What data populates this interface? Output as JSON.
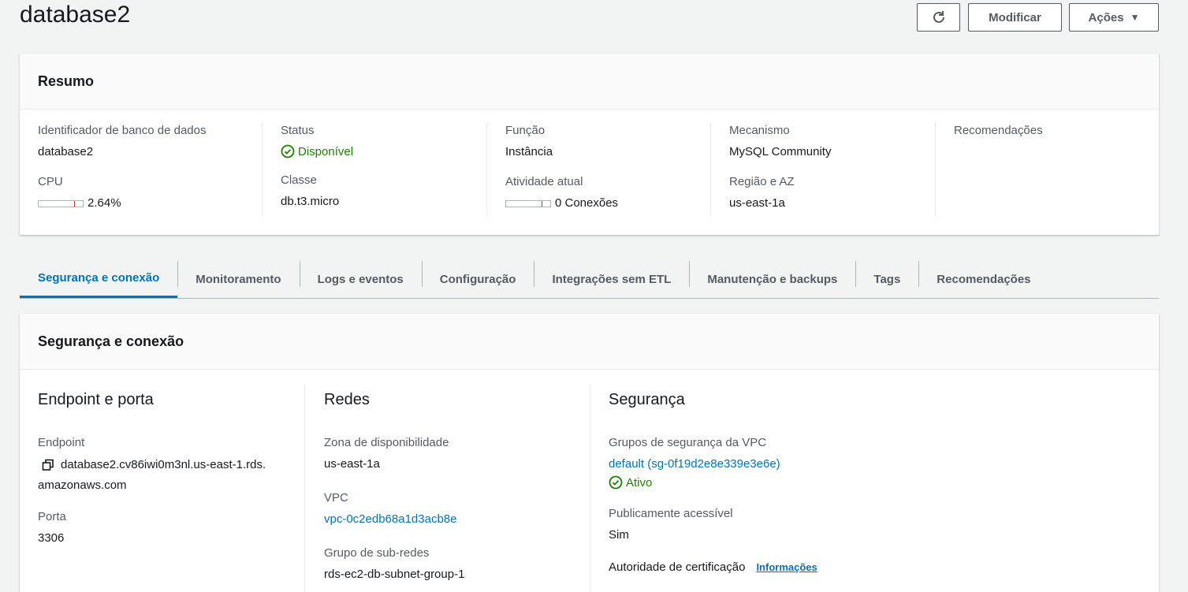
{
  "header": {
    "title": "database2",
    "modify_label": "Modificar",
    "actions_label": "Ações"
  },
  "summary": {
    "title": "Resumo",
    "identifier_label": "Identificador de banco de dados",
    "identifier_value": "database2",
    "cpu_label": "CPU",
    "cpu_value": "2.64%",
    "cpu_fraction": 0.0264,
    "status_label": "Status",
    "status_value": "Disponível",
    "class_label": "Classe",
    "class_value": "db.t3.micro",
    "role_label": "Função",
    "role_value": "Instância",
    "activity_label": "Atividade atual",
    "activity_value": "0 Conexões",
    "engine_label": "Mecanismo",
    "engine_value": "MySQL Community",
    "region_label": "Região e AZ",
    "region_value": "us-east-1a",
    "recommendations_label": "Recomendações"
  },
  "tabs": [
    {
      "label": "Segurança e conexão"
    },
    {
      "label": "Monitoramento"
    },
    {
      "label": "Logs e eventos"
    },
    {
      "label": "Configuração"
    },
    {
      "label": "Integrações sem ETL"
    },
    {
      "label": "Manutenção e backups"
    },
    {
      "label": "Tags"
    },
    {
      "label": "Recomendações"
    }
  ],
  "security": {
    "title": "Segurança e conexão",
    "endpoint_section": "Endpoint e porta",
    "endpoint_label": "Endpoint",
    "endpoint_line1": "database2.cv86iwi0m3nl.us-east-1.rds.",
    "endpoint_line2": "amazonaws.com",
    "port_label": "Porta",
    "port_value": "3306",
    "network_section": "Redes",
    "az_label": "Zona de disponibilidade",
    "az_value": "us-east-1a",
    "vpc_label": "VPC",
    "vpc_value": "vpc-0c2edb68a1d3acb8e",
    "subnet_label": "Grupo de sub-redes",
    "subnet_value": "rds-ec2-db-subnet-group-1",
    "security_section": "Segurança",
    "sg_label": "Grupos de segurança da VPC",
    "sg_value": "default (sg-0f19d2e8e339e3e6e)",
    "sg_status": "Ativo",
    "public_label": "Publicamente acessível",
    "public_value": "Sim",
    "ca_label": "Autoridade de certificação",
    "ca_info": "Informações"
  },
  "colors": {
    "accent": "#0073bb",
    "success": "#1d8102"
  },
  "icons": {
    "refresh": "refresh-icon",
    "caret": "caret-down-icon",
    "status": "check-circle-icon",
    "copy": "copy-icon"
  }
}
